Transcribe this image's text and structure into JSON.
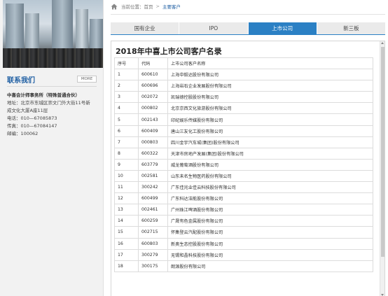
{
  "sidebar": {
    "contact_title": "联系我们",
    "more_label": "MORE",
    "firm_name": "中喜会计师事务所（特殊普通合伙）",
    "address_line1": "地址：北京市东城区崇文门外大街11号新",
    "address_line2": "成文化大厦A座11层",
    "phone": "电话：010—67085873",
    "fax": "传真：010—67084147",
    "postcode": "邮编：100062"
  },
  "breadcrumb": {
    "icon": "home-icon",
    "label": "当前位置：",
    "home": "首页",
    "separator": ">",
    "current": "主要客户"
  },
  "tabs": [
    {
      "label": "国有企业",
      "active": false
    },
    {
      "label": "IPO",
      "active": false
    },
    {
      "label": "上市公司",
      "active": true
    },
    {
      "label": "新三板",
      "active": false
    }
  ],
  "panel": {
    "title": "2018年中喜上市公司客户名录",
    "headers": [
      "序号",
      "代码",
      "上市公司客户名称"
    ],
    "rows": [
      [
        "1",
        "600610",
        "上海中毅达股份有限公司"
      ],
      [
        "2",
        "600696",
        "上海岩石企业发展股份有限公司"
      ],
      [
        "3",
        "002072",
        "凯瑞德控股股份有限公司"
      ],
      [
        "4",
        "000802",
        "北京京西文化旅游股份有限公司"
      ],
      [
        "5",
        "002143",
        "印纪娱乐传媒股份有限公司"
      ],
      [
        "6",
        "600409",
        "唐山三友化工股份有限公司"
      ],
      [
        "7",
        "000803",
        "四川金宇汽车城(集团)股份有限公司"
      ],
      [
        "8",
        "600322",
        "天津市房地产发展(集团)股份有限公司"
      ],
      [
        "9",
        "603779",
        "威龙葡萄酒股份有限公司"
      ],
      [
        "10",
        "002581",
        "山东未名生物医药股份有限公司"
      ],
      [
        "11",
        "300242",
        "广东佳兆业佳云科技股份有限公司"
      ],
      [
        "12",
        "600499",
        "广东科达洁能股份有限公司"
      ],
      [
        "13",
        "002461",
        "广州珠江啤酒股份有限公司"
      ],
      [
        "14",
        "600259",
        "广晟有色金属股份有限公司"
      ],
      [
        "15",
        "002715",
        "怀集登云汽配股份有限公司"
      ],
      [
        "16",
        "600803",
        "新奥生态控股股份有限公司"
      ],
      [
        "17",
        "300279",
        "无锡和晶科技股份有限公司"
      ],
      [
        "18",
        "300175",
        "朗源股份有限公司"
      ]
    ]
  },
  "colors": {
    "accent": "#2b80c4",
    "link": "#1f5fa3",
    "sidebar_bg": "#f2f2f2"
  }
}
